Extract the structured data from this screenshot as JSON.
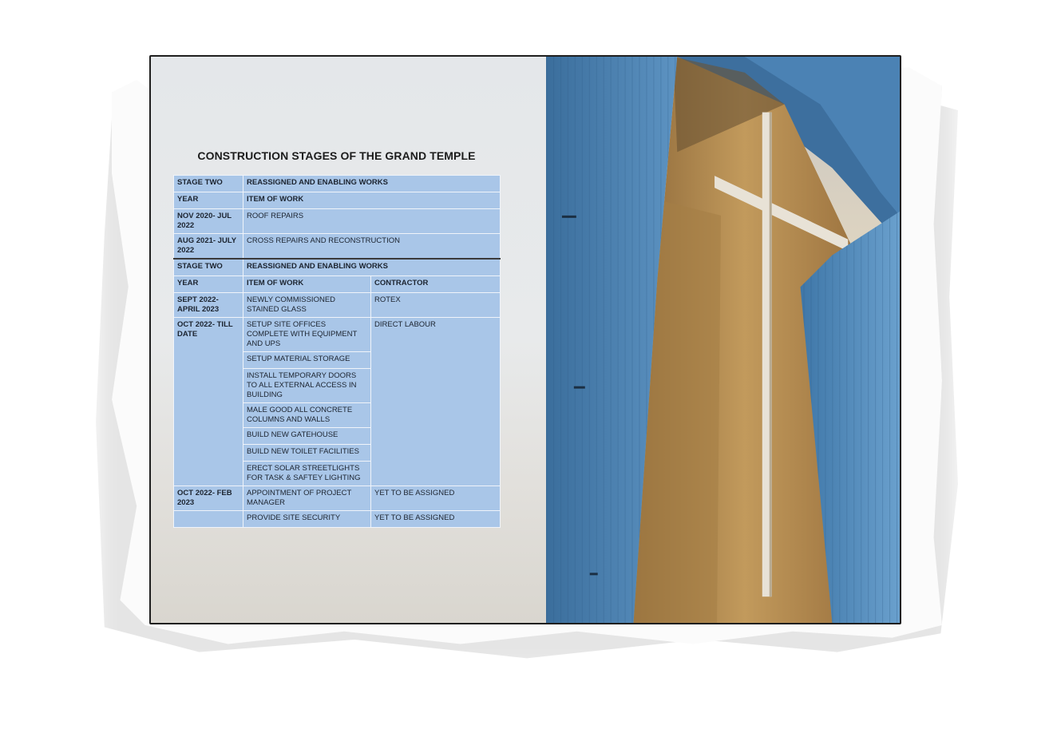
{
  "document": {
    "title": "CONSTRUCTION STAGES OF THE GRAND TEMPLE",
    "table1": {
      "header": [
        "STAGE TWO",
        "REASSIGNED AND ENABLING WORKS"
      ],
      "subheader": [
        "YEAR",
        "ITEM OF WORK"
      ],
      "rows": [
        {
          "year": "NOV 2020- JUL 2022",
          "item": "ROOF REPAIRS"
        },
        {
          "year": "AUG 2021- JULY 2022",
          "item": "CROSS REPAIRS AND RECONSTRUCTION"
        }
      ]
    },
    "table2": {
      "header": [
        "STAGE TWO",
        "REASSIGNED AND ENABLING WORKS"
      ],
      "subheader": [
        "YEAR",
        "ITEM OF WORK",
        "CONTRACTOR"
      ],
      "row_sept": {
        "year": "SEPT 2022- APRIL 2023",
        "item": "NEWLY COMMISSIONED STAINED GLASS",
        "contractor": "ROTEX"
      },
      "row_oct": {
        "year": "OCT 2022- TILL DATE",
        "contractor": "DIRECT LABOUR",
        "items": [
          "SETUP SITE OFFICES COMPLETE WITH EQUIPMENT AND UPS",
          "SETUP MATERIAL STORAGE",
          "INSTALL TEMPORARY DOORS TO ALL EXTERNAL ACCESS IN BUILDING",
          "MALE GOOD ALL CONCRETE COLUMNS AND WALLS",
          "BUILD NEW GATEHOUSE",
          "BUILD NEW TOILET FACILITIES",
          "ERECT SOLAR STREETLIGHTS FOR TASK & SAFTEY LIGHTING"
        ]
      },
      "row_feb": {
        "year": "OCT 2022- FEB 2023",
        "item": "APPOINTMENT OF  PROJECT MANAGER",
        "contractor": "YET TO BE ASSIGNED"
      },
      "row_security": {
        "year": "",
        "item": "PROVIDE SITE SECURITY",
        "contractor": "YET TO BE ASSIGNED"
      }
    }
  },
  "colors": {
    "table_cell": "#a9c6e8",
    "cladding_blue": "#4f86b8",
    "tower_gold": "#b88d4e"
  }
}
